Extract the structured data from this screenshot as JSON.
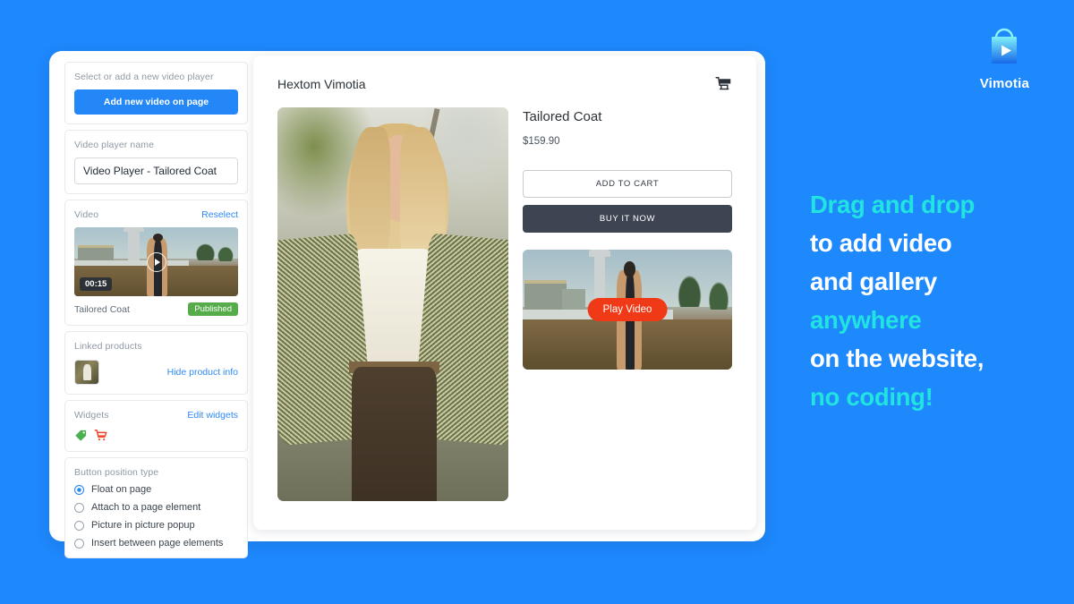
{
  "theme": {
    "background_blue": "#1E88FD",
    "accent_cyan": "#21E3DF",
    "primary_blue": "#2487f7",
    "published_green": "#56ac4b",
    "play_red": "#F03A17",
    "buy_dark": "#3E4552"
  },
  "sidebar": {
    "select_player": {
      "label": "Select or add a new video player",
      "add_button": "Add new video on page"
    },
    "player_name": {
      "label": "Video player name",
      "value": "Video Player - Tailored Coat"
    },
    "video": {
      "label": "Video",
      "reselect_link": "Reselect",
      "duration": "00:15",
      "caption": "Tailored Coat",
      "status_badge": "Published"
    },
    "linked_products": {
      "label": "Linked products",
      "toggle_link": "Hide product info"
    },
    "widgets": {
      "label": "Widgets",
      "edit_link": "Edit widgets",
      "icons": [
        "price-tag-icon",
        "shopping-cart-icon"
      ]
    },
    "button_position": {
      "label": "Button position type",
      "options": [
        {
          "label": "Float on page",
          "selected": true
        },
        {
          "label": "Attach to a page element",
          "selected": false
        },
        {
          "label": "Picture in picture popup",
          "selected": false
        },
        {
          "label": "Insert between page elements",
          "selected": false
        }
      ]
    }
  },
  "preview": {
    "shop_name": "Hextom Vimotia",
    "cart_icon": "shopping-cart-icon",
    "product": {
      "title": "Tailored Coat",
      "price": "$159.90",
      "add_to_cart": "ADD TO CART",
      "buy_it_now": "BUY IT NOW"
    },
    "video_widget": {
      "play_button": "Play Video"
    }
  },
  "branding": {
    "logo_icon": "shopping-bag-play-icon",
    "logo_name": "Vimotia",
    "headline_lines": [
      {
        "text": "Drag and drop",
        "accent": true
      },
      {
        "text": "to add video",
        "accent": false
      },
      {
        "text": "and gallery",
        "accent": false
      },
      {
        "text": "anywhere",
        "accent": true
      },
      {
        "text": "on the website,",
        "accent": false
      },
      {
        "text": "no coding!",
        "accent": true
      }
    ]
  }
}
